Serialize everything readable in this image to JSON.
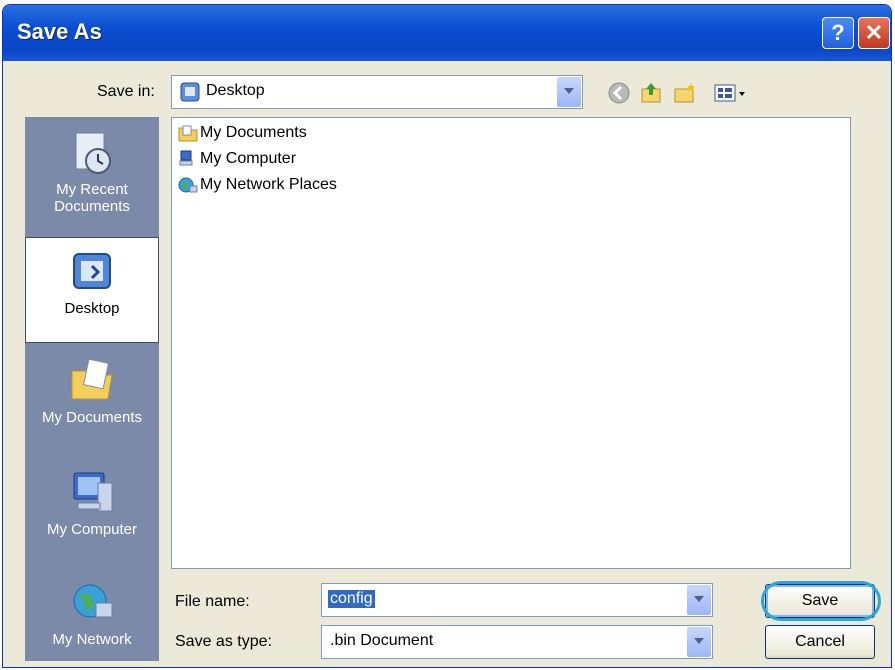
{
  "window": {
    "title": "Save As"
  },
  "titlebar": {
    "help_label": "?",
    "close_label": "✕"
  },
  "toolbar": {
    "save_in_label": "Save in:",
    "save_in_value": "Desktop"
  },
  "places": [
    {
      "label": "My Recent Documents",
      "line1": "My Recent",
      "line2": "Documents",
      "selected": false
    },
    {
      "label": "Desktop",
      "selected": true
    },
    {
      "label": "My Documents",
      "selected": false
    },
    {
      "label": "My Computer",
      "selected": false
    },
    {
      "label": "My Network",
      "selected": false
    }
  ],
  "files": [
    {
      "name": "My Documents",
      "icon": "folder-icon"
    },
    {
      "name": "My Computer",
      "icon": "computer-icon"
    },
    {
      "name": "My Network Places",
      "icon": "network-icon"
    }
  ],
  "form": {
    "file_name_label": "File name:",
    "file_name_value": "config",
    "save_as_type_label": "Save as type:",
    "save_as_type_value": ".bin Document"
  },
  "buttons": {
    "save_label": "Save",
    "cancel_label": "Cancel"
  },
  "colors": {
    "titlebar": "#0a4fd0",
    "dialog_bg": "#ece9d8",
    "places_bg": "#7b8aa8",
    "highlight_ring": "#2aa7d8"
  }
}
